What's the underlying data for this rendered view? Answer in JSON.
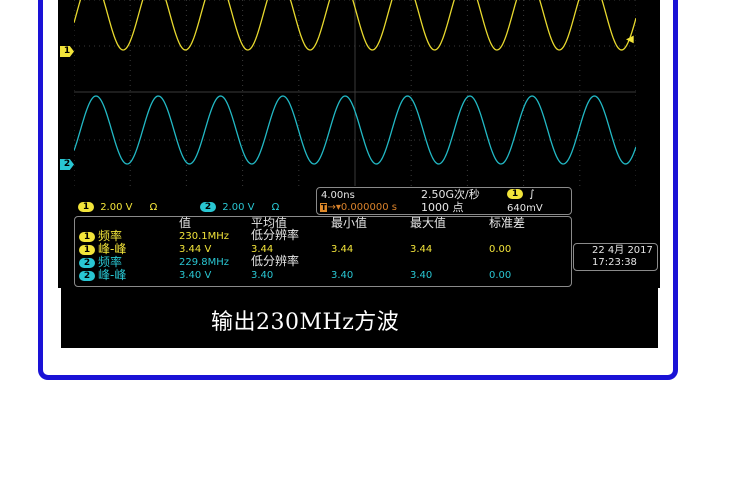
{
  "caption": "输出230MHz方波",
  "channels": {
    "ch1": {
      "label": "1",
      "scale": "2.00 V",
      "coupling_icon": "Ω",
      "color": "#f2e43a"
    },
    "ch2": {
      "label": "2",
      "scale": "2.00 V",
      "coupling_icon": "Ω",
      "color": "#29c6d2"
    }
  },
  "timebase": {
    "scale": "4.00ns",
    "sample_rate": "2.50G次/秒",
    "delay": "0.000000 s",
    "points": "1000 点",
    "trigger_channel": "1",
    "trigger_slope_icon": "rising-edge-icon",
    "trigger_level": "640mV"
  },
  "measurements": {
    "headers": [
      "值",
      "平均值",
      "最小值",
      "最大值",
      "标准差"
    ],
    "rows": [
      {
        "ch": "1",
        "name": "频率",
        "value": "230.1MHz",
        "mean": "低分辨率",
        "min": "",
        "max": "",
        "std": "",
        "color": "yellow"
      },
      {
        "ch": "1",
        "name": "峰-峰",
        "value": "3.44 V",
        "mean": "3.44",
        "min": "3.44",
        "max": "3.44",
        "std": "0.00",
        "color": "yellow"
      },
      {
        "ch": "2",
        "name": "频率",
        "value": "229.8MHz",
        "mean": "低分辨率",
        "min": "",
        "max": "",
        "std": "",
        "color": "cyan"
      },
      {
        "ch": "2",
        "name": "峰-峰",
        "value": "3.40 V",
        "mean": "3.40",
        "min": "3.40",
        "max": "3.40",
        "std": "0.00",
        "color": "cyan"
      }
    ]
  },
  "datetime": {
    "date": "22 4月 2017",
    "time": "17:23:38"
  },
  "waveform_frequency_mhz": 230,
  "trigger_arrow_icon": "trigger-level-arrow-icon"
}
